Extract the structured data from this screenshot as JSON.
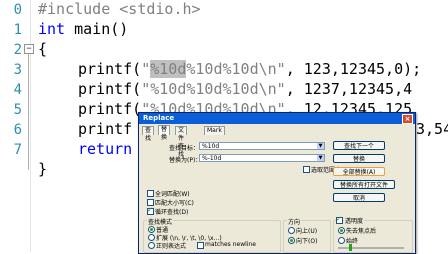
{
  "editor": {
    "line_numbers": [
      "0",
      "1",
      "2",
      "3",
      "4",
      "5",
      "6",
      "7"
    ],
    "lines": {
      "l0": {
        "pre": "#include <stdio.h>"
      },
      "l1": {
        "kw": "int",
        "rest": " main()"
      },
      "l2": {
        "text": "{"
      },
      "l3": {
        "fn": "printf(",
        "q": "\"",
        "sel": "%10d",
        "s2": "%10d%10d\\n\"",
        "args": ", 123,12345,0);"
      },
      "l4": {
        "fn": "printf(",
        "s": "\"%10d%10d%10d\\n\"",
        "args": ", 1237,12345,4"
      },
      "l5": {
        "fn": "printf(",
        "s": "\"%10d%10d%10d\\n\"",
        "args": ", 12,12345,125"
      },
      "l6": {
        "fn": "printf",
        "tail": "3,54);"
      },
      "l7": {
        "kw": "return"
      },
      "l8": {
        "text": "}"
      }
    }
  },
  "dialog": {
    "title": "Replace",
    "close": "×",
    "tabs": [
      "查找",
      "替换",
      "文件查找",
      "Mark"
    ],
    "find_label": "查找目标：",
    "find_value": "%10d",
    "replace_label": "替换为(P)：",
    "replace_value": "%-10d",
    "in_selection": "选取范围内",
    "buttons": {
      "find_next": "查找下一个",
      "replace": "替换",
      "replace_all": "全部替换(A)",
      "replace_all_open": "替换所有打开文件",
      "cancel": "取消"
    },
    "options": {
      "whole_word": "全词匹配(W)",
      "match_case": "匹配大小写(C)",
      "wrap": "循环查找(D)"
    },
    "search_mode": {
      "title": "查找模式",
      "normal": "普通",
      "extended": "扩展 (\\n, \\r, \\t, \\0, \\x...)",
      "regex": "正则表达式",
      "newline": "matches newline"
    },
    "direction": {
      "title": "方向",
      "up": "向上(U)",
      "down": "向下(O)"
    },
    "transparency": {
      "title": "透明度",
      "on_lose_focus": "失去焦点后",
      "always": "始终"
    }
  }
}
